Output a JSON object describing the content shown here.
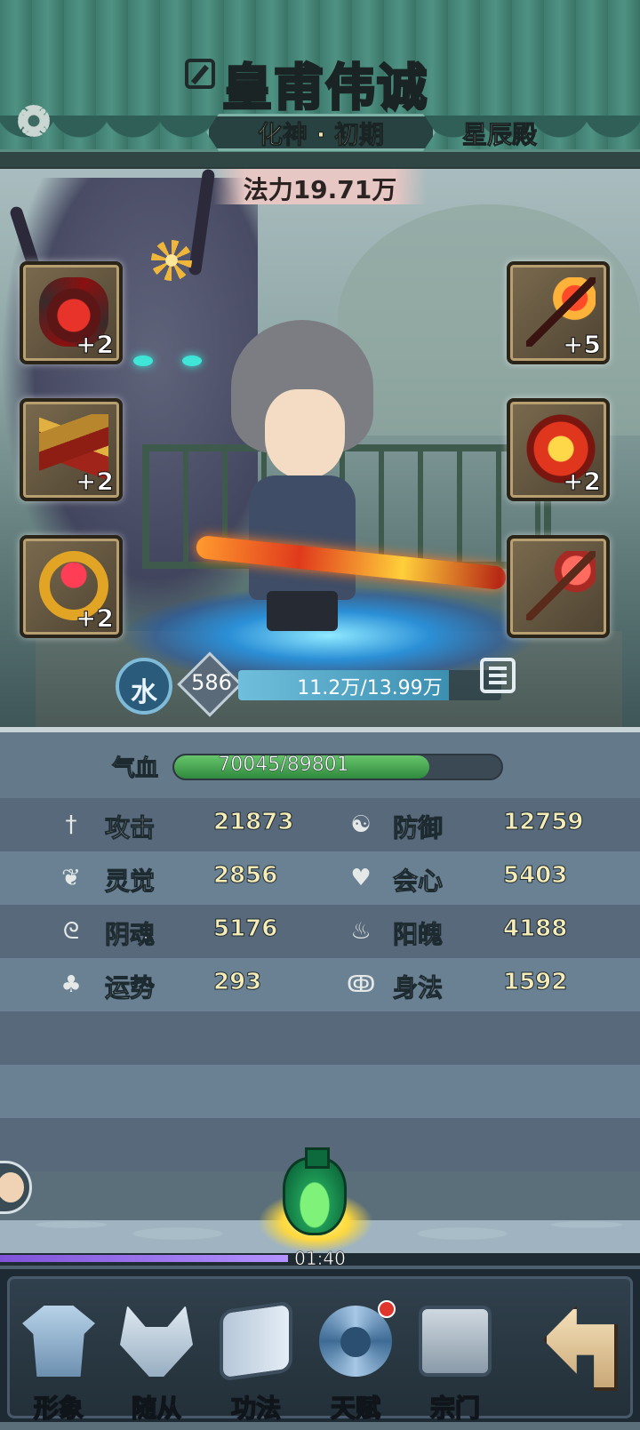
{
  "header": {
    "player_name": "皇甫伟诚",
    "realm": "化神 · 初期",
    "sect": "星辰殿",
    "icons": {
      "edit": "edit-icon",
      "settings": "gear-icon"
    }
  },
  "scene": {
    "power_label": "法力19.71万",
    "equipment_left": [
      {
        "name": "helmet",
        "level": "+2"
      },
      {
        "name": "boots",
        "level": "+2"
      },
      {
        "name": "ring",
        "level": "+2"
      }
    ],
    "equipment_right": [
      {
        "name": "staff",
        "level": "+5"
      },
      {
        "name": "armor",
        "level": "+2"
      },
      {
        "name": "mace",
        "level": ""
      }
    ],
    "element": "水",
    "level": "586",
    "exp_text": "11.2万/13.99万",
    "exp_fraction": 0.8
  },
  "stats": {
    "hp_label": "气血",
    "hp_text": "70045/89801",
    "hp_fraction": 0.78,
    "rows": [
      {
        "left": {
          "icon": "sword-icon",
          "name": "攻击",
          "value": "21873"
        },
        "right": {
          "icon": "yin-yang-icon",
          "name": "防御",
          "value": "12759"
        }
      },
      {
        "left": {
          "icon": "eye-lotus-icon",
          "name": "灵觉",
          "value": "2856"
        },
        "right": {
          "icon": "heart-icon",
          "name": "会心",
          "value": "5403"
        }
      },
      {
        "left": {
          "icon": "yin-soul-icon",
          "name": "阴魂",
          "value": "5176"
        },
        "right": {
          "icon": "flame-icon",
          "name": "阳魄",
          "value": "4188"
        }
      },
      {
        "left": {
          "icon": "clover-icon",
          "name": "运势",
          "value": "293"
        },
        "right": {
          "icon": "swirl-icon",
          "name": "身法",
          "value": "1592"
        }
      }
    ]
  },
  "idle": {
    "timer": "01:40",
    "progress_fraction": 0.45
  },
  "nav": {
    "items": [
      {
        "label": "形象",
        "icon": "robe-icon"
      },
      {
        "label": "随从",
        "icon": "wolf-icon"
      },
      {
        "label": "功法",
        "icon": "book-icon"
      },
      {
        "label": "天赋",
        "icon": "swirl-icon"
      },
      {
        "label": "宗门",
        "icon": "gate-icon"
      }
    ],
    "back_icon": "return-arrow-icon"
  },
  "colors": {
    "header": "#4f9283",
    "hp_green": "#2f8a3d",
    "stat_value": "#f6ecb7",
    "timer_purple": "#7f52d8"
  }
}
